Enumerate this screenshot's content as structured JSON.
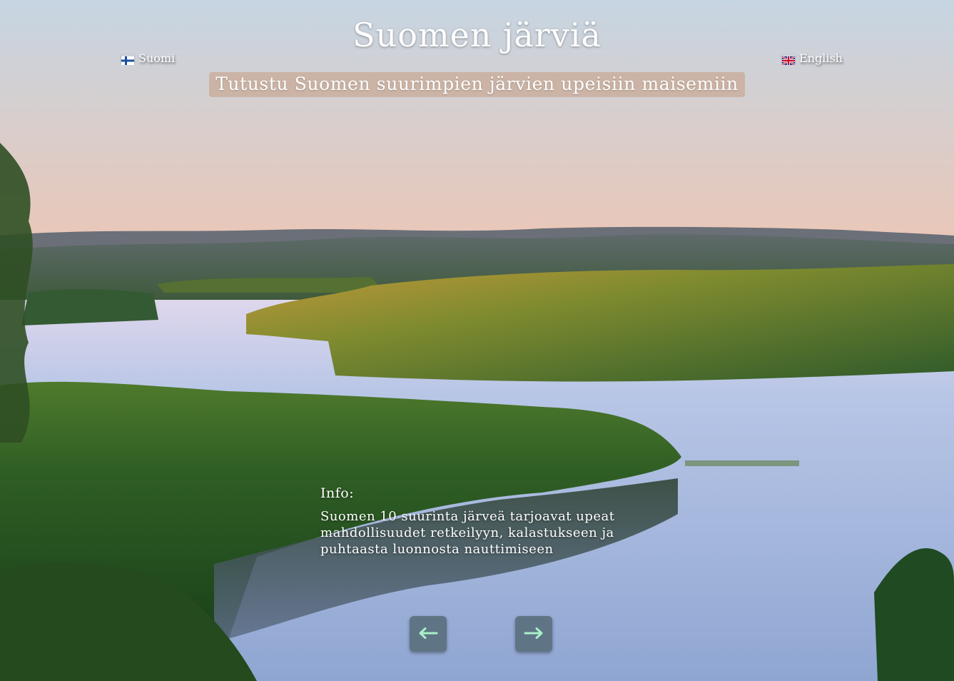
{
  "header": {
    "title": "Suomen järviä",
    "subtitle": "Tutustu Suomen suurimpien järvien upeisiin maisemiin"
  },
  "language": {
    "finnish_label": "Suomi",
    "finnish_flag": "finland-flag-icon",
    "english_label": "English",
    "english_flag": "uk-flag-icon"
  },
  "info": {
    "heading": "Info:",
    "text": "Suomen 10 suurinta järveä tarjoavat upeat mahdollisuudet retkeilyyn, kalastukseen ja puhtaasta luonnosta nauttimiseen"
  },
  "navigation": {
    "prev_icon": "arrow-left-icon",
    "next_icon": "arrow-right-icon",
    "button_color": "#5f7585",
    "arrow_color": "#a8f0c8"
  },
  "colors": {
    "sky_top": "#c8d6e2",
    "sky_bottom": "#f6b49a",
    "water": "#a9bfe0",
    "forest": "#2d5a2a"
  }
}
